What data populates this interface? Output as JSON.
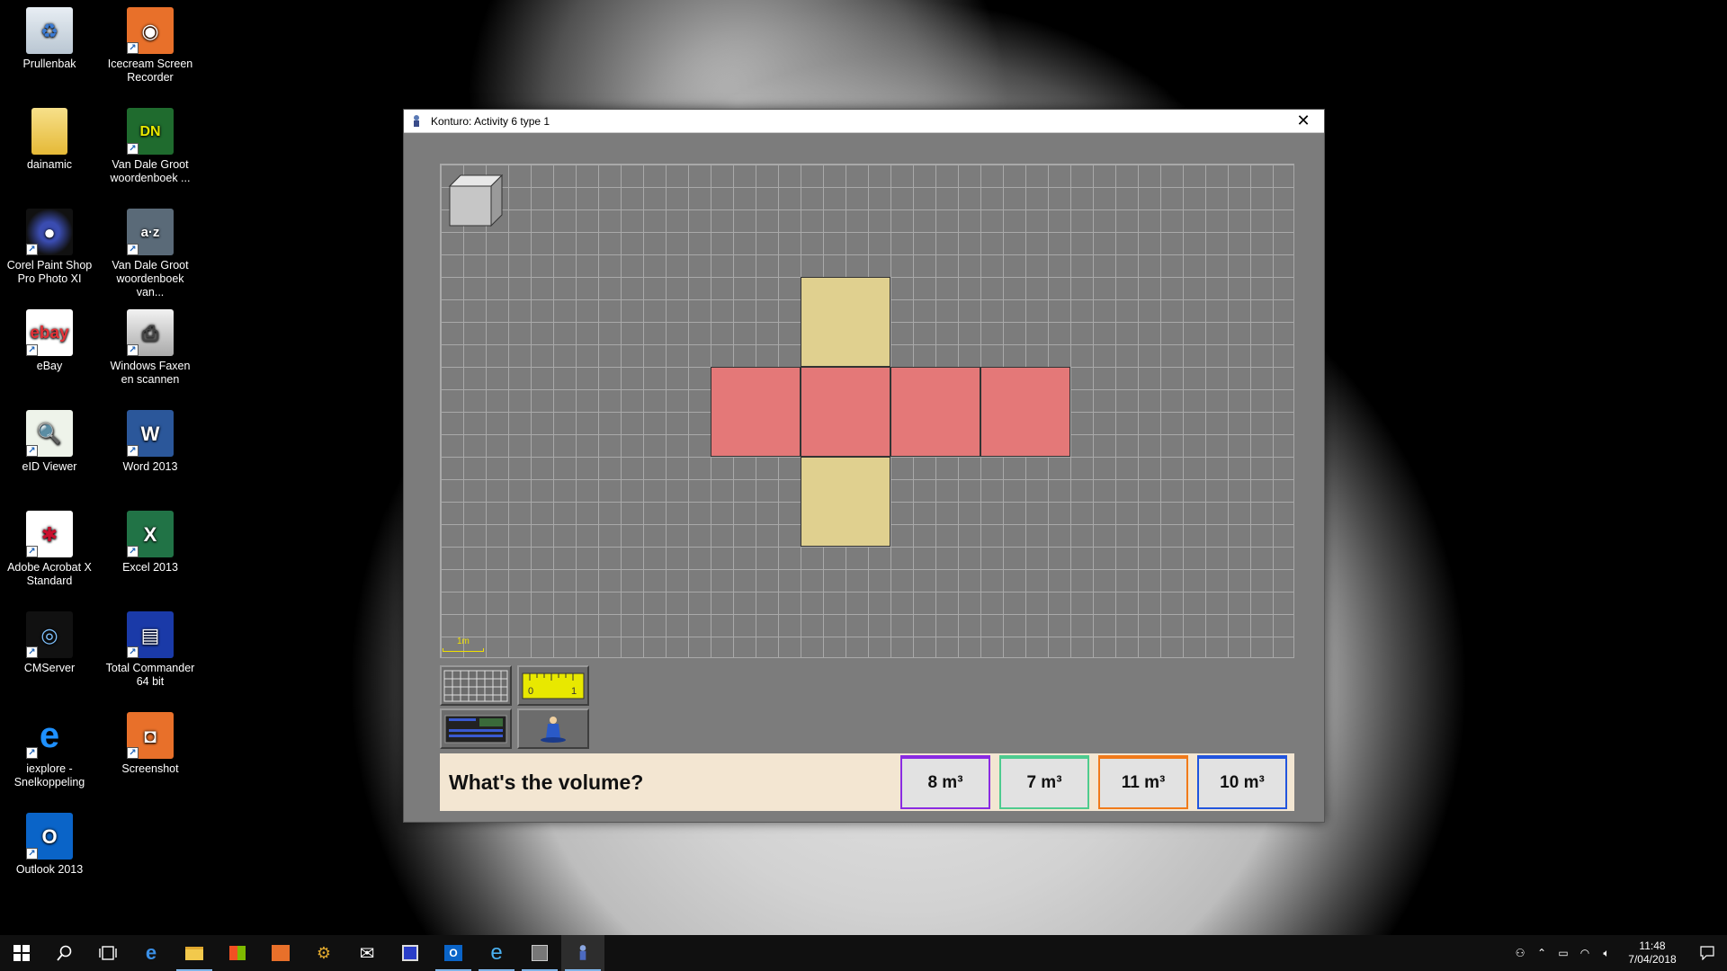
{
  "desktop": {
    "icons": [
      {
        "label": "Prullenbak",
        "icon": "recycle-bin-icon"
      },
      {
        "label": "Icecream Screen Recorder",
        "icon": "screen-recorder-icon"
      },
      {
        "label": "dainamic",
        "icon": "folder-icon"
      },
      {
        "label": "Van Dale Groot woordenboek ...",
        "icon": "dictionary-icon"
      },
      {
        "label": "Corel Paint Shop Pro Photo XI",
        "icon": "paint-shop-icon"
      },
      {
        "label": "Van Dale Groot woordenboek van...",
        "icon": "dictionary-az-icon"
      },
      {
        "label": "eBay",
        "icon": "ebay-icon"
      },
      {
        "label": "Windows Faxen en scannen",
        "icon": "fax-scan-icon"
      },
      {
        "label": "eID Viewer",
        "icon": "eid-viewer-icon"
      },
      {
        "label": "Word 2013",
        "icon": "word-icon"
      },
      {
        "label": "Adobe Acrobat X Standard",
        "icon": "acrobat-icon"
      },
      {
        "label": "Excel 2013",
        "icon": "excel-icon"
      },
      {
        "label": "CMServer",
        "icon": "cmserver-icon"
      },
      {
        "label": "Total Commander 64 bit",
        "icon": "total-commander-icon"
      },
      {
        "label": "iexplore - Snelkoppeling",
        "icon": "internet-explorer-icon"
      },
      {
        "label": "Screenshot",
        "icon": "screenshot-icon"
      },
      {
        "label": "Outlook 2013",
        "icon": "outlook-icon"
      }
    ]
  },
  "window": {
    "title": "Konturo: Activity 6 type 1",
    "close_glyph": "✕",
    "scale_label": "1m",
    "question": "What's the volume?",
    "answers": [
      {
        "label": "8 m³",
        "color": "#8a2be2"
      },
      {
        "label": "7 m³",
        "color": "#4ecb8f"
      },
      {
        "label": "11 m³",
        "color": "#f07a1a"
      },
      {
        "label": "10 m³",
        "color": "#2255dd"
      }
    ],
    "net_colors": {
      "top_bottom": "#e0d08f",
      "sides": "#e47878"
    }
  },
  "taskbar": {
    "clock_time": "11:48",
    "clock_date": "7/04/2018"
  }
}
